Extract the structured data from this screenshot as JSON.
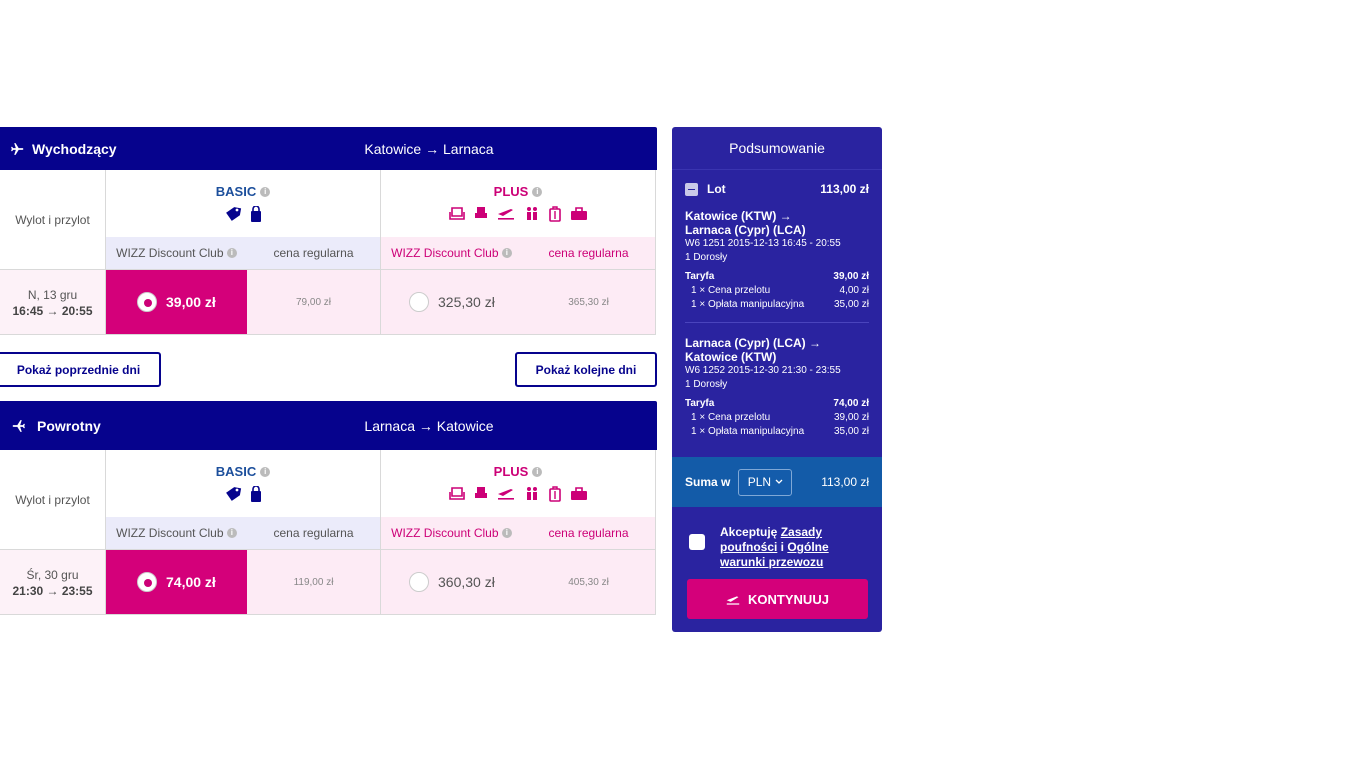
{
  "outbound": {
    "direction_label": "Wychodzący",
    "route": "Katowice → Larnaca",
    "row_label": "Wylot i przylot",
    "basic_name": "BASIC",
    "plus_name": "PLUS",
    "wdc_label": "WIZZ Discount Club",
    "regular_label": "cena regularna",
    "date": "N, 13 gru",
    "times": "16:45 → 20:55",
    "basic_wdc_price": "39,00 zł",
    "basic_regular_price": "79,00 zł",
    "plus_wdc_price": "325,30 zł",
    "plus_regular_price": "365,30 zł"
  },
  "nav": {
    "prev_days": "Pokaż poprzednie dni",
    "next_days": "Pokaż kolejne dni"
  },
  "return": {
    "direction_label": "Powrotny",
    "route": "Larnaca → Katowice",
    "row_label": "Wylot i przylot",
    "basic_name": "BASIC",
    "plus_name": "PLUS",
    "wdc_label": "WIZZ Discount Club",
    "regular_label": "cena regularna",
    "date": "Śr, 30 gru",
    "times": "21:30 → 23:55",
    "basic_wdc_price": "74,00 zł",
    "basic_regular_price": "119,00 zł",
    "plus_wdc_price": "360,30 zł",
    "plus_regular_price": "405,30 zł"
  },
  "summary": {
    "title": "Podsumowanie",
    "lot_label": "Lot",
    "lot_total": "113,00 zł",
    "leg1": {
      "from": "Katowice (KTW) →",
      "to": "Larnaca (Cypr) (LCA)",
      "flight": "W6 1251  2015-12-13 16:45 - 20:55",
      "pax": "1 Dorosły",
      "fare_label": "Taryfa",
      "fare_total": "39,00 zł",
      "item1_label": "1 × Cena przelotu",
      "item1_price": "4,00 zł",
      "item2_label": "1 × Opłata manipulacyjna",
      "item2_price": "35,00 zł"
    },
    "leg2": {
      "from": "Larnaca (Cypr) (LCA) →",
      "to": "Katowice (KTW)",
      "flight": "W6 1252  2015-12-30 21:30 - 23:55",
      "pax": "1 Dorosły",
      "fare_label": "Taryfa",
      "fare_total": "74,00 zł",
      "item1_label": "1 × Cena przelotu",
      "item1_price": "39,00 zł",
      "item2_label": "1 × Opłata manipulacyjna",
      "item2_price": "35,00 zł"
    },
    "sum_label": "Suma w",
    "currency": "PLN",
    "sum_total": "113,00 zł",
    "accept_prefix": "Akceptuję ",
    "accept_link1": "Zasady poufności",
    "accept_mid": " i ",
    "accept_link2": "Ogólne warunki przewozu",
    "continue": "KONTYNUUJ"
  },
  "colors": {
    "navy": "#06038d",
    "magenta": "#d4007a",
    "pink_bg": "#fdebf5",
    "summary_bg": "#2a23a0",
    "sum_bar": "#135ba8"
  }
}
